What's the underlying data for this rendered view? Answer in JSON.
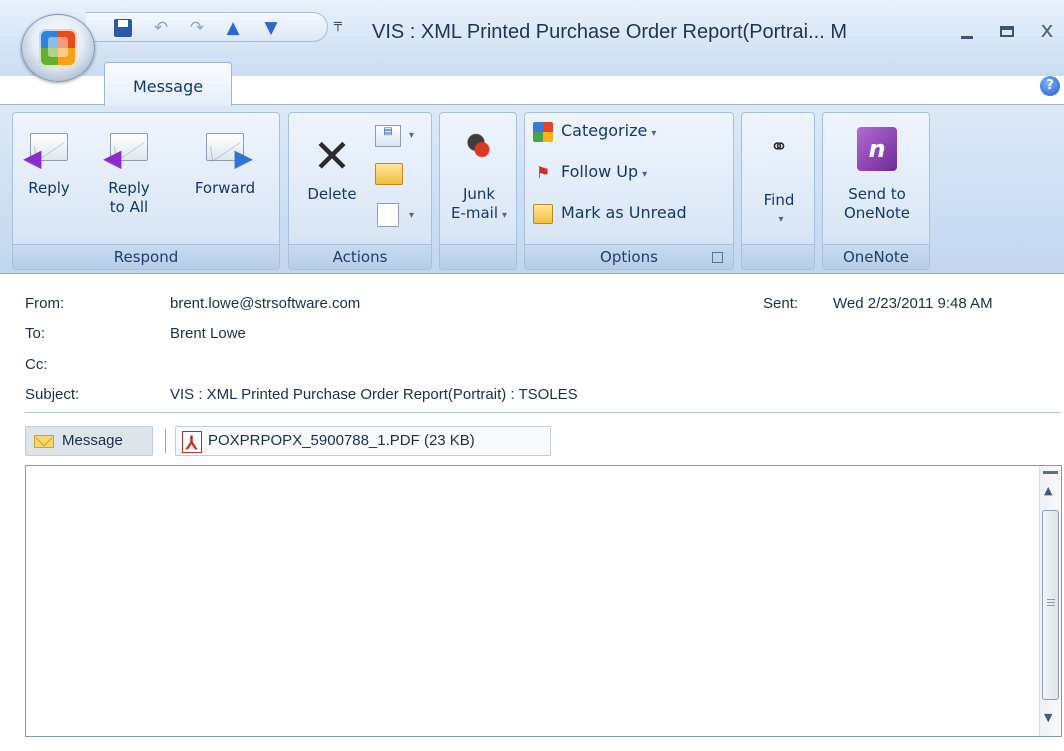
{
  "window": {
    "title": "VIS : XML Printed Purchase Order Report(Portrai... M",
    "minimize": "",
    "maximize": "",
    "close": "x"
  },
  "qat": {
    "save": "",
    "undo": "↶",
    "redo": "↷",
    "up": "▲",
    "down": "▼",
    "customize": "╤"
  },
  "tabs": [
    {
      "label": "Message"
    }
  ],
  "help": "?",
  "ribbon": {
    "groups": {
      "respond": "Respond",
      "actions": "Actions",
      "junk": "",
      "options": "Options",
      "find": "",
      "onenote": "OneNote"
    },
    "reply": "Reply",
    "reply_all_line1": "Reply",
    "reply_all_line2": "to All",
    "forward": "Forward",
    "delete": "Delete",
    "junk_line1": "Junk",
    "junk_line2": "E-mail",
    "categorize": "Categorize",
    "follow_up": "Follow Up",
    "mark_unread": "Mark as Unread",
    "find": "Find",
    "send_onenote_line1": "Send to",
    "send_onenote_line2": "OneNote"
  },
  "header": {
    "from_label": "From:",
    "from_value": "brent.lowe@strsoftware.com",
    "to_label": "To:",
    "to_value": "Brent Lowe",
    "cc_label": "Cc:",
    "cc_value": "",
    "subject_label": "Subject:",
    "subject_value": "VIS : XML Printed Purchase Order Report(Portrait) : TSOLES",
    "sent_label": "Sent:",
    "sent_value": "Wed 2/23/2011 9:48 AM"
  },
  "attachments": {
    "message_label": "Message",
    "pdf_label": "POXPRPOPX_5900788_1.PDF (23 KB)"
  },
  "body": {
    "text": ""
  }
}
